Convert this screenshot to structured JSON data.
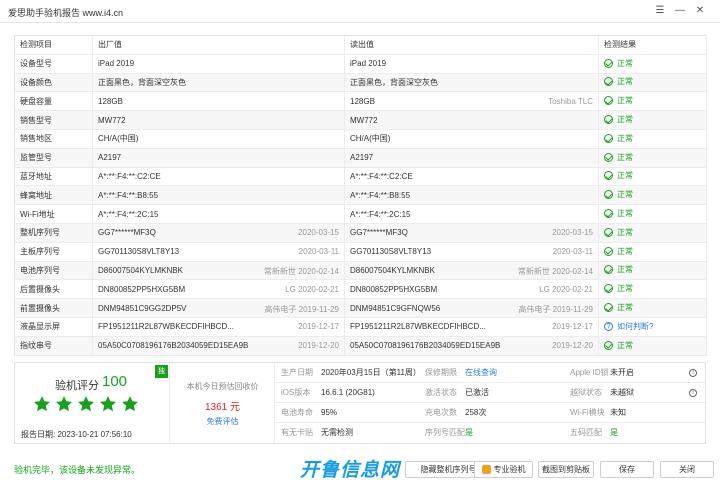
{
  "window": {
    "title": "爱思助手验机报告 www.i4.cn",
    "controls": [
      "☰",
      "—",
      "✕"
    ]
  },
  "table": {
    "headers": [
      "检测项目",
      "出厂值",
      "读出值",
      "检测结果"
    ],
    "rows": [
      {
        "item": "设备型号",
        "factory": "iPad 2019",
        "factory_meta": "",
        "read": "iPad 2019",
        "read_meta": "",
        "result": "正常",
        "type": "ok"
      },
      {
        "item": "设备颜色",
        "factory": "正面黑色，背面深空灰色",
        "factory_meta": "",
        "read": "正面黑色，背面深空灰色",
        "read_meta": "",
        "result": "正常",
        "type": "ok"
      },
      {
        "item": "硬盘容量",
        "factory": "128GB",
        "factory_meta": "",
        "read": "128GB",
        "read_meta": "Toshiba TLC",
        "result": "正常",
        "type": "ok"
      },
      {
        "item": "销售型号",
        "factory": "MW772",
        "factory_meta": "",
        "read": "MW772",
        "read_meta": "",
        "result": "正常",
        "type": "ok"
      },
      {
        "item": "销售地区",
        "factory": "CH/A(中国)",
        "factory_meta": "",
        "read": "CH/A(中国)",
        "read_meta": "",
        "result": "正常",
        "type": "ok"
      },
      {
        "item": "监管型号",
        "factory": "A2197",
        "factory_meta": "",
        "read": "A2197",
        "read_meta": "",
        "result": "正常",
        "type": "ok"
      },
      {
        "item": "蓝牙地址",
        "factory": "A*:**:F4:**:C2:CE",
        "factory_meta": "",
        "read": "A*:**:F4:**:C2:CE",
        "read_meta": "",
        "result": "正常",
        "type": "ok"
      },
      {
        "item": "蜂窝地址",
        "factory": "A*:**:F4:**:B8:55",
        "factory_meta": "",
        "read": "A*:**:F4:**:B8:55",
        "read_meta": "",
        "result": "正常",
        "type": "ok"
      },
      {
        "item": "Wi-Fi地址",
        "factory": "A*:**:F4:**:2C:15",
        "factory_meta": "",
        "read": "A*:**:F4:**:2C:15",
        "read_meta": "",
        "result": "正常",
        "type": "ok"
      },
      {
        "item": "整机序列号",
        "factory": "GG7******MF3Q",
        "factory_meta": "2020-03-15",
        "read": "GG7******MF3Q",
        "read_meta": "2020-03-15",
        "result": "正常",
        "type": "ok"
      },
      {
        "item": "主板序列号",
        "factory": "GG701130S8VLT8Y13",
        "factory_meta": "2020-03-11",
        "read": "GG701130S8VLT8Y13",
        "read_meta": "2020-03-11",
        "result": "正常",
        "type": "ok"
      },
      {
        "item": "电池序列号",
        "factory": "D86007504KYLMKNBK",
        "factory_meta": "常新新世  2020-02-14",
        "read": "D86007504KYLMKNBK",
        "read_meta": "常新新世  2020-02-14",
        "result": "正常",
        "type": "ok"
      },
      {
        "item": "后置摄像头",
        "factory": "DN800852PP5HXG5BM",
        "factory_meta": "LG  2020-02-21",
        "read": "DN800852PP5HXG5BM",
        "read_meta": "LG  2020-02-21",
        "result": "正常",
        "type": "ok"
      },
      {
        "item": "前置摄像头",
        "factory": "DNM94851C9GG2DP5V",
        "factory_meta": "高伟电子  2019-11-29",
        "read": "DNM94851C9GFNQW56",
        "read_meta": "高伟电子  2019-11-29",
        "result": "正常",
        "type": "ok"
      },
      {
        "item": "液晶显示屏",
        "factory": "FP1951211R2L87WBKECDFIHBCD...",
        "factory_meta": "2019-12-17",
        "read": "FP1951211R2L87WBKECDFIHBCD...",
        "read_meta": "2019-12-17",
        "result": "如何判断?",
        "type": "info"
      },
      {
        "item": "指纹串号",
        "factory": "05A50C0708196176B2034059ED15EA9B",
        "factory_meta": "2019-12-20",
        "read": "05A50C0708196176B2034059ED15EA9B",
        "read_meta": "2019-12-20",
        "result": "正常",
        "type": "ok"
      }
    ]
  },
  "summary": {
    "score_label": "验机评分",
    "score": "100",
    "badge": "独",
    "stars": 5,
    "report_date": "报告日期:  2023-10-21 07:56:10",
    "price_label": "本机今日预估回收价",
    "price": "1361 元",
    "price_link": "免费评估",
    "info_rows": [
      [
        {
          "k": "生产日期",
          "v": "2020年03月15日（第11周）",
          "style": ""
        },
        {
          "k": "保修期限",
          "v": "在线查询",
          "style": "link"
        },
        {
          "k": "Apple ID锁",
          "v": "未开启",
          "style": ""
        }
      ],
      [
        {
          "k": "iOS版本",
          "v": "16.6.1 (20G81)",
          "style": ""
        },
        {
          "k": "激活状态",
          "v": "已激活",
          "style": ""
        },
        {
          "k": "越狱状态",
          "v": "未越狱",
          "style": ""
        }
      ],
      [
        {
          "k": "电池寿命",
          "v": "95%",
          "style": ""
        },
        {
          "k": "充电次数",
          "v": "258次",
          "style": ""
        },
        {
          "k": "Wi-Fi模块",
          "v": "未知",
          "style": ""
        }
      ],
      [
        {
          "k": "有无卡贴",
          "v": "无需检测",
          "style": ""
        },
        {
          "k": "序列号匹配",
          "v": "是",
          "style": "green"
        },
        {
          "k": "五码匹配",
          "v": "是",
          "style": "green"
        }
      ]
    ]
  },
  "footer": {
    "status": "验机完毕，该设备未发现异常。",
    "watermark": "开鲁信息网",
    "buttons": [
      "隐藏整机序列号",
      "专业验机",
      "截图到剪贴板",
      "保存",
      "关闭"
    ]
  }
}
